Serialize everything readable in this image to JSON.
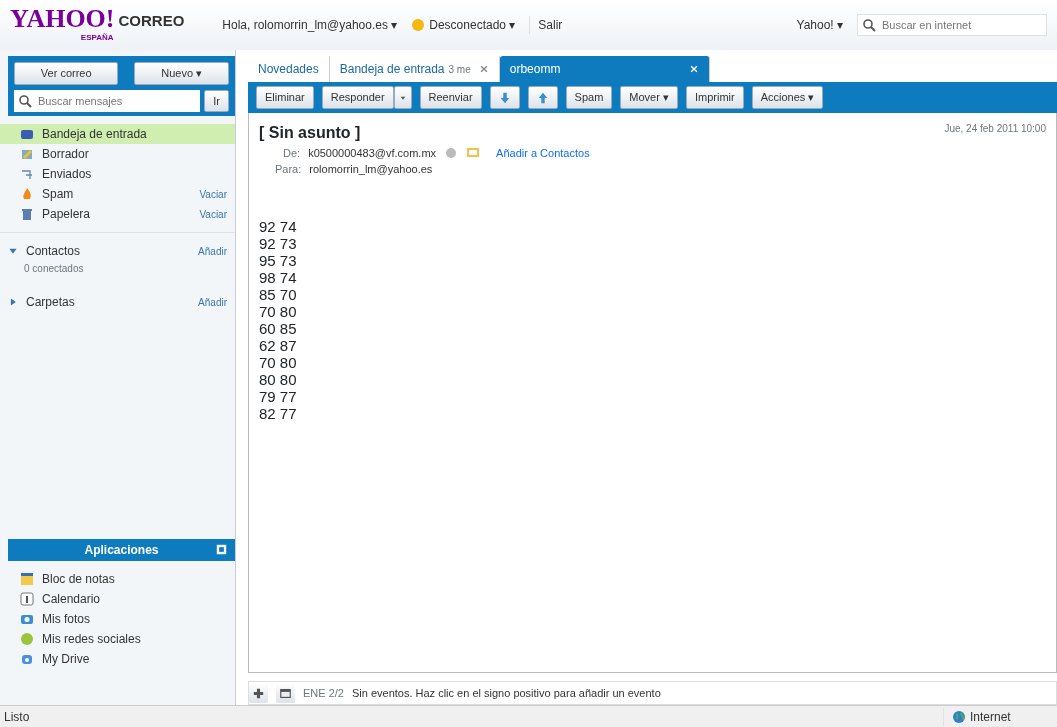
{
  "header": {
    "logo": "YAHOO!",
    "logo_suffix": "CORREO",
    "logo_region": "ESPAÑA",
    "greeting": "Hola, rolomorrin_lm@yahoo.es ▾",
    "status": "Desconectado ▾",
    "signout": "Salir",
    "yahoo_menu": "Yahoo! ▾",
    "web_search": {
      "placeholder": "Buscar en internet"
    }
  },
  "sidebar": {
    "check_button": "Ver correo",
    "new_button": "Nuevo ▾",
    "search": {
      "placeholder": "Buscar mensajes"
    },
    "search_button": "Ir",
    "folders": [
      {
        "label": "Bandeja de entrada",
        "selected": true
      },
      {
        "label": "Borrador",
        "selected": false
      },
      {
        "label": "Enviados",
        "selected": false
      },
      {
        "label": "Spam",
        "selected": false,
        "action": "Vaciar"
      },
      {
        "label": "Papelera",
        "selected": false,
        "action": "Vaciar"
      }
    ],
    "sections": [
      {
        "label": "Contactos",
        "expanded": true,
        "action": "Añadir",
        "detail": "0 conectados"
      },
      {
        "label": "Carpetas",
        "expanded": false,
        "action": "Añadir"
      }
    ],
    "apps_title": "Aplicaciones",
    "apps": [
      {
        "label": "Bloc de notas"
      },
      {
        "label": "Calendario"
      },
      {
        "label": "Mis fotos"
      },
      {
        "label": "Mis redes sociales"
      },
      {
        "label": "My Drive"
      }
    ]
  },
  "tabs": [
    {
      "label": "Novedades",
      "selected": false
    },
    {
      "label": "Bandeja de entrada",
      "count": "3 me",
      "selected": false,
      "closable": true
    },
    {
      "label": "orbeomm",
      "selected": true,
      "closable": true
    }
  ],
  "toolbar": [
    {
      "label": "Eliminar",
      "kind": "button"
    },
    {
      "label": "Responder",
      "kind": "split"
    },
    {
      "label": "Reenviar",
      "kind": "button"
    },
    {
      "kind": "down"
    },
    {
      "kind": "up"
    },
    {
      "label": "Spam",
      "kind": "button"
    },
    {
      "label": "Mover ▾",
      "kind": "button"
    },
    {
      "label": "Imprimir",
      "kind": "button"
    },
    {
      "label": "Acciones ▾",
      "kind": "button"
    }
  ],
  "message": {
    "subject": "[ Sin asunto ]",
    "date": "Jue, 24 feb 2011 10:00",
    "from_label": "De:",
    "from": "k0500000483@vf.com.mx",
    "add_contact": "Añadir a Contactos",
    "to_label": "Para:",
    "to": "rolomorrin_lm@yahoo.es",
    "body": [
      "92 74",
      "92 73",
      "95 73",
      "98 74",
      "85 70",
      "70 80",
      "60 85",
      "62 87",
      "70 80",
      "80 80",
      "79 77",
      "82 77"
    ]
  },
  "calendar_bar": {
    "date": "ENE 2/2",
    "text": "Sin eventos. Haz clic en el signo positivo para añadir un evento"
  },
  "status_bar": {
    "text": "Listo",
    "zone": "Internet"
  }
}
